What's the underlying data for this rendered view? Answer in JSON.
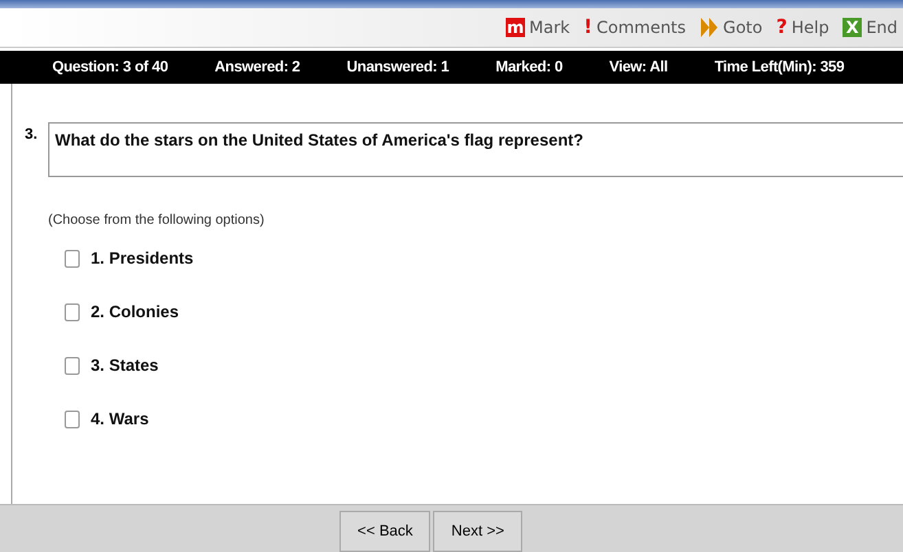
{
  "toolbar": [
    {
      "kind": "boxed",
      "glyph": "m",
      "color": "#e01010",
      "label": "Mark"
    },
    {
      "kind": "plain",
      "glyph": "!",
      "color": "#e01010",
      "label": "Comments"
    },
    {
      "kind": "arrows",
      "color": "#d98a00",
      "label": "Goto"
    },
    {
      "kind": "plain",
      "glyph": "?",
      "color": "#e01010",
      "label": "Help"
    },
    {
      "kind": "boxed",
      "glyph": "X",
      "color": "#4a9a2a",
      "label": "End"
    }
  ],
  "status_bar": [
    "Question: 3 of 40",
    "Answered: 2",
    "Unanswered: 1",
    "Marked: 0",
    "View: All",
    "Time Left(Min): 359"
  ],
  "question": {
    "number": "3.",
    "text": "What do the stars on the United States of America's flag represent?"
  },
  "instruction": "(Choose from the following options)",
  "options": [
    {
      "label": "1. Presidents",
      "checked": false
    },
    {
      "label": "2. Colonies",
      "checked": false
    },
    {
      "label": "3. States",
      "checked": false
    },
    {
      "label": "4. Wars",
      "checked": false
    }
  ],
  "buttons": [
    "<< Back",
    "Next >>"
  ]
}
